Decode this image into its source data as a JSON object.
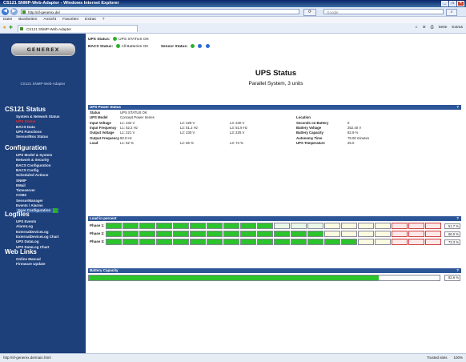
{
  "browser": {
    "title": "CS121 SNMP-Web-Adapter - Windows Internet Explorer",
    "url": "http://sf-generex.de/",
    "search_placeholder": "Google",
    "menu": [
      "Datei",
      "Bearbeiten",
      "Ansicht",
      "Favoriten",
      "Extras",
      "?"
    ],
    "tab_title": "CS121 SNMP-Web-Adapter",
    "tools": [
      "Seite",
      "Extras"
    ],
    "status_left": "http://sf-generex.de/main.html",
    "status_zone": "Trusted sites",
    "zoom": "100%"
  },
  "header": {
    "logo_text": "GENEREX",
    "ups_status_label": "UPS Status:",
    "ups_status_value": "UPS STATUS OK",
    "bacs_status_label": "BACS Status:",
    "bacs_status_value": "All Batteries OK",
    "sensor_status_label": "Sensor Status:"
  },
  "sidebar": {
    "version": "CS121 SNMP-Web-Adapter",
    "sections": [
      {
        "title": "CS121 Status",
        "items": [
          "System & Network Status",
          "UPS Status",
          "BACS Data",
          "UPS Functions",
          "Sensor/Box Status"
        ]
      },
      {
        "title": "Configuration",
        "items": [
          "UPS Model & System",
          "Network & Security",
          "BACS Configuration",
          "BACS Config",
          "Scheduled Actions",
          "SNMP",
          "EMail",
          "Timeserver",
          "COM2",
          "SensorManager",
          "Events / Alarms",
          "Save Configuration"
        ]
      },
      {
        "title": "Logfiles",
        "items": [
          "UPS Events",
          "AlarmLog",
          "ExternalDeviceLog",
          "ExternalDeviceLog Chart",
          "UPS DataLog",
          "UPS DataLog Chart"
        ]
      },
      {
        "title": "Web Links",
        "items": [
          "Online Manual",
          "Firmware Update"
        ]
      }
    ]
  },
  "main": {
    "title": "UPS Status",
    "subtitle": "Parallel System, 3 units",
    "power_status": {
      "heading": "UPS Power Status",
      "help": "?",
      "status_label": "Status",
      "status_value": "UPS STATUS OK",
      "model_label": "UPS Model",
      "model_value": "Concept Power Series",
      "location_label": "Location",
      "rows": [
        {
          "label": "Input Voltage",
          "l1": "L1: 232 V",
          "l2": "L2: 228 V",
          "l3": "L3: 230 V",
          "rlabel": "Seconds on Battery",
          "rvalue": "0"
        },
        {
          "label": "Input Frequency",
          "l1": "L1: 52.2 Hz",
          "l2": "L2: 51.2 Hz",
          "l3": "L3: 51.9 Hz",
          "rlabel": "Battery Voltage",
          "rvalue": "252.40 V"
        },
        {
          "label": "Output Voltage",
          "l1": "L1: 221 V",
          "l2": "L2: 230 V",
          "l3": "L3: 225 V",
          "rlabel": "Battery Capacity",
          "rvalue": "82.9 %"
        },
        {
          "label": "Output Frequency",
          "l1": "50.0 Hz",
          "l2": "",
          "l3": "",
          "rlabel": "Autonomy Time",
          "rvalue": "75.00 minutes"
        },
        {
          "label": "Load",
          "l1": "L1: 52 %",
          "l2": "L2: 66 %",
          "l3": "L3: 73 %",
          "rlabel": "UPS Temperature",
          "rvalue": "25.0"
        }
      ]
    },
    "load": {
      "heading": "Load in percent",
      "help": "?",
      "phases": [
        {
          "label": "Phase 1:",
          "percent": 51.7,
          "display": "51.7 %"
        },
        {
          "label": "Phase 2:",
          "percent": 66.0,
          "display": "66.0 %"
        },
        {
          "label": "Phase 3:",
          "percent": 73.3,
          "display": "73.3 %"
        }
      ]
    },
    "battery": {
      "heading": "Battery Capacity",
      "help": "?",
      "percent": 82.6,
      "display": "82.6 %"
    }
  }
}
